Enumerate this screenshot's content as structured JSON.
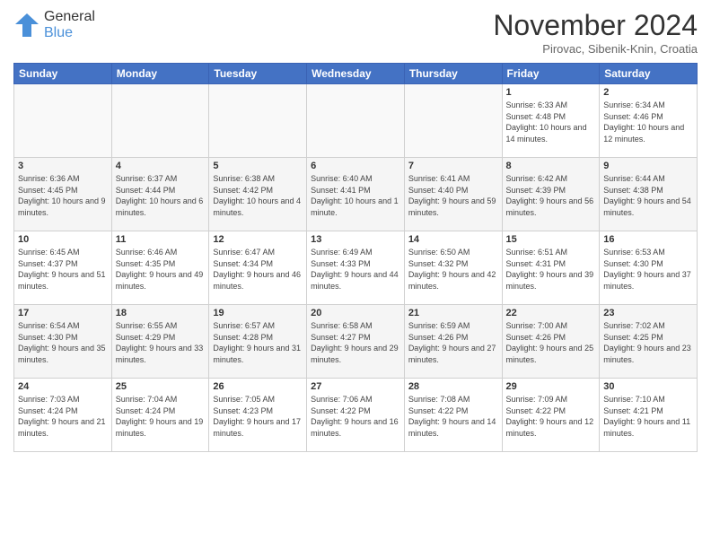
{
  "header": {
    "logo_general": "General",
    "logo_blue": "Blue",
    "month_title": "November 2024",
    "location": "Pirovac, Sibenik-Knin, Croatia"
  },
  "calendar": {
    "days_of_week": [
      "Sunday",
      "Monday",
      "Tuesday",
      "Wednesday",
      "Thursday",
      "Friday",
      "Saturday"
    ],
    "weeks": [
      [
        {
          "day": "",
          "info": ""
        },
        {
          "day": "",
          "info": ""
        },
        {
          "day": "",
          "info": ""
        },
        {
          "day": "",
          "info": ""
        },
        {
          "day": "",
          "info": ""
        },
        {
          "day": "1",
          "info": "Sunrise: 6:33 AM\nSunset: 4:48 PM\nDaylight: 10 hours and 14 minutes."
        },
        {
          "day": "2",
          "info": "Sunrise: 6:34 AM\nSunset: 4:46 PM\nDaylight: 10 hours and 12 minutes."
        }
      ],
      [
        {
          "day": "3",
          "info": "Sunrise: 6:36 AM\nSunset: 4:45 PM\nDaylight: 10 hours and 9 minutes."
        },
        {
          "day": "4",
          "info": "Sunrise: 6:37 AM\nSunset: 4:44 PM\nDaylight: 10 hours and 6 minutes."
        },
        {
          "day": "5",
          "info": "Sunrise: 6:38 AM\nSunset: 4:42 PM\nDaylight: 10 hours and 4 minutes."
        },
        {
          "day": "6",
          "info": "Sunrise: 6:40 AM\nSunset: 4:41 PM\nDaylight: 10 hours and 1 minute."
        },
        {
          "day": "7",
          "info": "Sunrise: 6:41 AM\nSunset: 4:40 PM\nDaylight: 9 hours and 59 minutes."
        },
        {
          "day": "8",
          "info": "Sunrise: 6:42 AM\nSunset: 4:39 PM\nDaylight: 9 hours and 56 minutes."
        },
        {
          "day": "9",
          "info": "Sunrise: 6:44 AM\nSunset: 4:38 PM\nDaylight: 9 hours and 54 minutes."
        }
      ],
      [
        {
          "day": "10",
          "info": "Sunrise: 6:45 AM\nSunset: 4:37 PM\nDaylight: 9 hours and 51 minutes."
        },
        {
          "day": "11",
          "info": "Sunrise: 6:46 AM\nSunset: 4:35 PM\nDaylight: 9 hours and 49 minutes."
        },
        {
          "day": "12",
          "info": "Sunrise: 6:47 AM\nSunset: 4:34 PM\nDaylight: 9 hours and 46 minutes."
        },
        {
          "day": "13",
          "info": "Sunrise: 6:49 AM\nSunset: 4:33 PM\nDaylight: 9 hours and 44 minutes."
        },
        {
          "day": "14",
          "info": "Sunrise: 6:50 AM\nSunset: 4:32 PM\nDaylight: 9 hours and 42 minutes."
        },
        {
          "day": "15",
          "info": "Sunrise: 6:51 AM\nSunset: 4:31 PM\nDaylight: 9 hours and 39 minutes."
        },
        {
          "day": "16",
          "info": "Sunrise: 6:53 AM\nSunset: 4:30 PM\nDaylight: 9 hours and 37 minutes."
        }
      ],
      [
        {
          "day": "17",
          "info": "Sunrise: 6:54 AM\nSunset: 4:30 PM\nDaylight: 9 hours and 35 minutes."
        },
        {
          "day": "18",
          "info": "Sunrise: 6:55 AM\nSunset: 4:29 PM\nDaylight: 9 hours and 33 minutes."
        },
        {
          "day": "19",
          "info": "Sunrise: 6:57 AM\nSunset: 4:28 PM\nDaylight: 9 hours and 31 minutes."
        },
        {
          "day": "20",
          "info": "Sunrise: 6:58 AM\nSunset: 4:27 PM\nDaylight: 9 hours and 29 minutes."
        },
        {
          "day": "21",
          "info": "Sunrise: 6:59 AM\nSunset: 4:26 PM\nDaylight: 9 hours and 27 minutes."
        },
        {
          "day": "22",
          "info": "Sunrise: 7:00 AM\nSunset: 4:26 PM\nDaylight: 9 hours and 25 minutes."
        },
        {
          "day": "23",
          "info": "Sunrise: 7:02 AM\nSunset: 4:25 PM\nDaylight: 9 hours and 23 minutes."
        }
      ],
      [
        {
          "day": "24",
          "info": "Sunrise: 7:03 AM\nSunset: 4:24 PM\nDaylight: 9 hours and 21 minutes."
        },
        {
          "day": "25",
          "info": "Sunrise: 7:04 AM\nSunset: 4:24 PM\nDaylight: 9 hours and 19 minutes."
        },
        {
          "day": "26",
          "info": "Sunrise: 7:05 AM\nSunset: 4:23 PM\nDaylight: 9 hours and 17 minutes."
        },
        {
          "day": "27",
          "info": "Sunrise: 7:06 AM\nSunset: 4:22 PM\nDaylight: 9 hours and 16 minutes."
        },
        {
          "day": "28",
          "info": "Sunrise: 7:08 AM\nSunset: 4:22 PM\nDaylight: 9 hours and 14 minutes."
        },
        {
          "day": "29",
          "info": "Sunrise: 7:09 AM\nSunset: 4:22 PM\nDaylight: 9 hours and 12 minutes."
        },
        {
          "day": "30",
          "info": "Sunrise: 7:10 AM\nSunset: 4:21 PM\nDaylight: 9 hours and 11 minutes."
        }
      ]
    ]
  }
}
